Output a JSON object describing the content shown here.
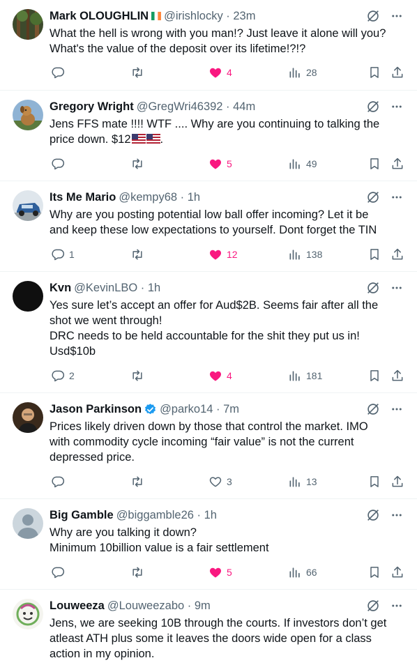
{
  "colors": {
    "like_active": "#f91880",
    "secondary_text": "#536471",
    "verified": "#1d9bf0"
  },
  "posts": [
    {
      "name": "Mark OLOUGHLIN",
      "flag": "ireland-flag",
      "meta": "@irishlocky · 23m",
      "lines": [
        "What the hell is wrong with you man!? Just leave it alone will you?",
        "What's the value of the deposit over its lifetime!?!?"
      ],
      "replies": "",
      "reposts": "",
      "likes": "4",
      "liked": true,
      "views": "28"
    },
    {
      "name": "Gregory Wright",
      "meta": "@GregWri46392 · 44m",
      "lines": [
        "Jens FFS mate !!!!  WTF .... Why are you continuing to talking the",
        "price down. $12"
      ],
      "line_suffix": ".",
      "replies": "",
      "reposts": "",
      "likes": "5",
      "liked": true,
      "views": "49"
    },
    {
      "name": "Its Me Mario",
      "meta": "@kempy68 · 1h",
      "lines": [
        "Why are you posting potential low ball offer incoming? Let it be",
        "and keep these low expectations to yourself. Dont forget the TIN"
      ],
      "replies": "1",
      "reposts": "",
      "likes": "12",
      "liked": true,
      "views": "138"
    },
    {
      "name": "Kvn",
      "meta": "@KevinLBO · 1h",
      "lines": [
        "Yes sure let’s accept an offer for Aud$2B. Seems fair after all the",
        "shot we went through!",
        "DRC needs to be held accountable for the shit they put us in!",
        "Usd$10b"
      ],
      "replies": "2",
      "reposts": "",
      "likes": "4",
      "liked": true,
      "views": "181"
    },
    {
      "name": "Jason Parkinson",
      "verified": true,
      "meta": "@parko14 · 7m",
      "lines": [
        "Prices likely driven down by those that control the market. IMO",
        "with commodity cycle incoming “fair value” is not the current",
        "depressed price."
      ],
      "replies": "",
      "reposts": "",
      "likes": "3",
      "liked": false,
      "views": "13"
    },
    {
      "name": "Big Gamble",
      "meta": "@biggamble26 · 1h",
      "lines": [
        "Why are you talking it down?",
        "Minimum 10billion value is a fair settlement"
      ],
      "replies": "",
      "reposts": "",
      "likes": "5",
      "liked": true,
      "views": "66"
    },
    {
      "name": "Louweeza",
      "meta": "@Louweezabo · 9m",
      "lines": [
        "Jens, we are seeking 10B through the courts. If investors don’t get",
        "atleast ATH plus some it leaves the doors wide open for a class",
        "action in my opinion."
      ],
      "replies": "",
      "reposts": "",
      "likes": "",
      "liked": false,
      "views": ""
    }
  ]
}
